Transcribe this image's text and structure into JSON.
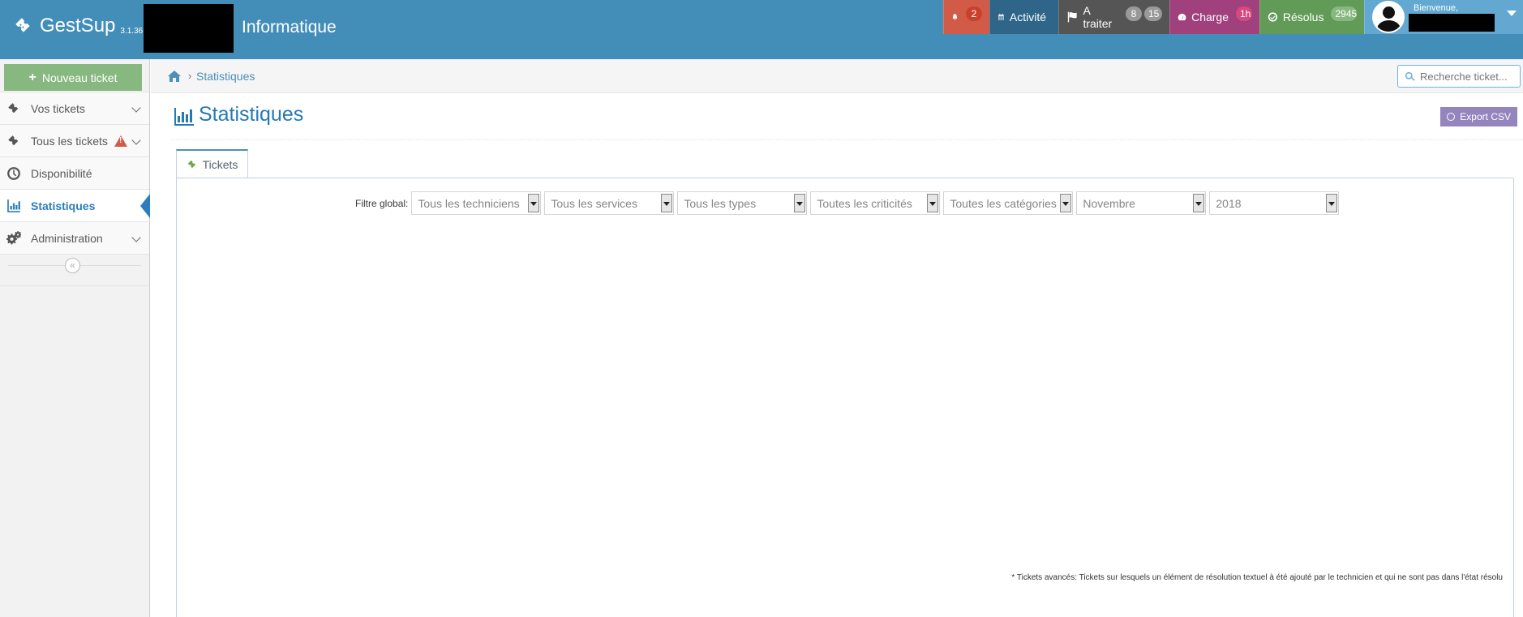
{
  "app": {
    "name": "GestSup",
    "version": "3.1.36",
    "department": "Informatique"
  },
  "navbar": {
    "alert_count": "2",
    "activity_label": "Activité",
    "todo_label": "A traiter",
    "todo_count_1": "8",
    "todo_count_2": "15",
    "charge_label": "Charge",
    "charge_value": "1h",
    "resolved_label": "Résolus",
    "resolved_count": "2945",
    "welcome_text": "Bienvenue,"
  },
  "sidebar": {
    "new_ticket_label": "Nouveau ticket",
    "items": [
      {
        "label": "Vos tickets"
      },
      {
        "label": "Tous les tickets"
      },
      {
        "label": "Disponibilité"
      },
      {
        "label": "Statistiques"
      },
      {
        "label": "Administration"
      }
    ],
    "collapse_glyph": "«"
  },
  "breadcrumb": {
    "separator": "›",
    "current": "Statistiques"
  },
  "search": {
    "placeholder": "Recherche ticket..."
  },
  "page": {
    "title": "Statistiques",
    "export_label": "Export CSV"
  },
  "tabs": [
    {
      "label": "Tickets",
      "active": true
    }
  ],
  "filters": {
    "label": "Filtre global:",
    "technician": "Tous les techniciens",
    "service": "Tous les services",
    "type": "Tous les types",
    "criticality": "Toutes les criticités",
    "category": "Toutes les catégories",
    "month": "Novembre",
    "year": "2018"
  },
  "footnote": "* Tickets avancés: Tickets sur lesquels un élément de résolution textuel à été ajouté par le technicien et qui ne sont pas dans l'état résolu",
  "colors": {
    "navbar": "#438eb9",
    "alert": "#d15b47",
    "activity": "#2e6589",
    "todo": "#555555",
    "charge": "#a0417e",
    "resolved": "#629b58",
    "user": "#62a8d1",
    "accent": "#2679b5",
    "new_ticket": "#87b87f",
    "export": "#9585bf"
  }
}
